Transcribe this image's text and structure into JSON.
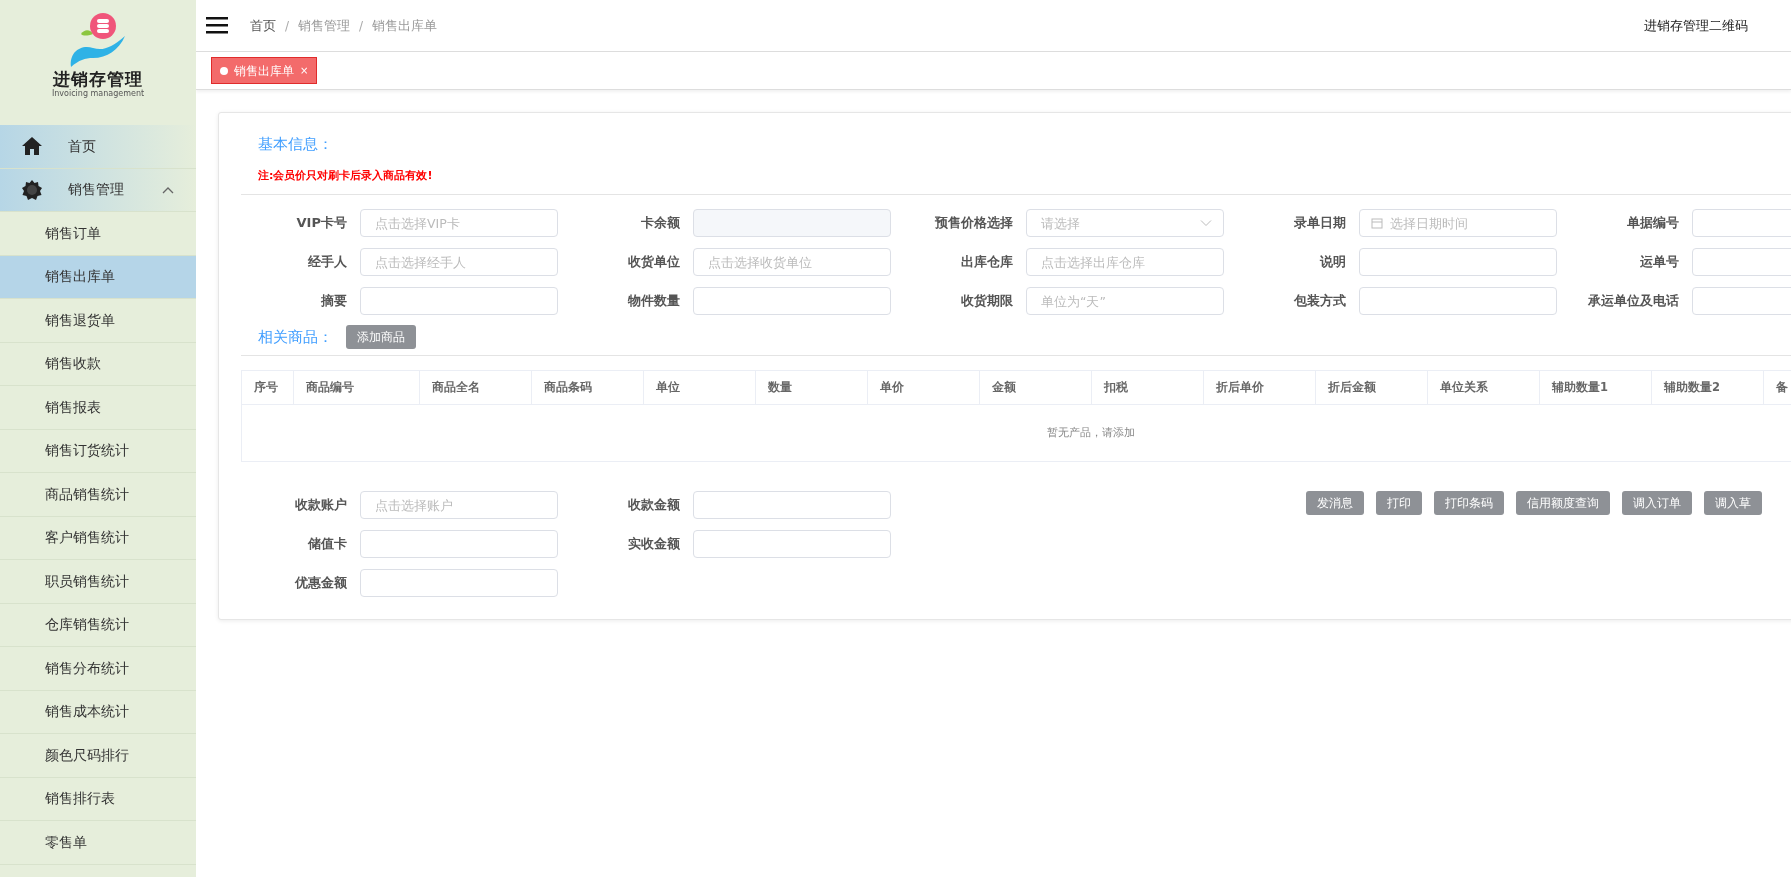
{
  "sidebar": {
    "logo": {
      "title": "进销存管理",
      "subtitle": "Invoicing management"
    },
    "items": [
      {
        "label": "首页",
        "selected": false
      },
      {
        "label": "销售管理",
        "selected": false,
        "expanded": true,
        "children": [
          {
            "label": "销售订单",
            "selected": false
          },
          {
            "label": "销售出库单",
            "selected": true
          },
          {
            "label": "销售退货单",
            "selected": false
          },
          {
            "label": "销售收款",
            "selected": false
          },
          {
            "label": "销售报表",
            "selected": false
          },
          {
            "label": "销售订货统计",
            "selected": false
          },
          {
            "label": "商品销售统计",
            "selected": false
          },
          {
            "label": "客户销售统计",
            "selected": false
          },
          {
            "label": "职员销售统计",
            "selected": false
          },
          {
            "label": "仓库销售统计",
            "selected": false
          },
          {
            "label": "销售分布统计",
            "selected": false
          },
          {
            "label": "销售成本统计",
            "selected": false
          },
          {
            "label": "颜色尺码排行",
            "selected": false
          },
          {
            "label": "销售排行表",
            "selected": false
          },
          {
            "label": "零售单",
            "selected": false
          }
        ]
      }
    ]
  },
  "header": {
    "breadcrumb": [
      {
        "kind": "link",
        "text": "首页"
      },
      {
        "kind": "separator",
        "text": "/"
      },
      {
        "kind": "link",
        "text": "销售管理"
      },
      {
        "kind": "separator",
        "text": "/"
      },
      {
        "kind": "link",
        "text": "销售出库单"
      }
    ],
    "links": [
      "进销存管理二维码"
    ]
  },
  "tabs": [
    {
      "label": "销售出库单",
      "selected": true,
      "close": "×"
    }
  ],
  "basic_info": {
    "title": "基本信息：",
    "note": "注:会员价只对刷卡后录入商品有效!",
    "fields": [
      {
        "label": "VIP卡号",
        "kind": "text",
        "placeholder": "点击选择VIP卡"
      },
      {
        "label": "卡余额",
        "kind": "disabled"
      },
      {
        "label": "预售价格选择",
        "kind": "select",
        "placeholder": "请选择"
      },
      {
        "label": "录单日期",
        "kind": "date",
        "placeholder": "选择日期时间"
      },
      {
        "label": "单据编号",
        "kind": "text"
      },
      {
        "label": "经手人",
        "kind": "text",
        "placeholder": "点击选择经手人"
      },
      {
        "label": "收货单位",
        "kind": "text",
        "placeholder": "点击选择收货单位"
      },
      {
        "label": "出库仓库",
        "kind": "text",
        "placeholder": "点击选择出库仓库"
      },
      {
        "label": "说明",
        "kind": "text"
      },
      {
        "label": "运单号",
        "kind": "text"
      },
      {
        "label": "摘要",
        "kind": "text"
      },
      {
        "label": "物件数量",
        "kind": "text"
      },
      {
        "label": "收货期限",
        "kind": "text",
        "placeholder": "单位为“天”"
      },
      {
        "label": "包装方式",
        "kind": "text"
      },
      {
        "label": "承运单位及电话",
        "kind": "text"
      }
    ]
  },
  "products": {
    "title": "相关商品：",
    "add_button": "添加商品",
    "columns": [
      "序号",
      "商品编号",
      "商品全名",
      "商品条码",
      "单位",
      "数量",
      "单价",
      "金额",
      "扣税",
      "折后单价",
      "折后金额",
      "单位关系",
      "辅助数量1",
      "辅助数量2",
      "备"
    ],
    "empty_text": "暂无产品，请添加"
  },
  "payment": {
    "fields": [
      {
        "label": "收款账户",
        "placeholder": "点击选择账户"
      },
      {
        "label": "收款金额"
      },
      {
        "label": "储值卡"
      },
      {
        "label": "实收金额"
      },
      {
        "label": "优惠金额"
      }
    ]
  },
  "actions": [
    "发消息",
    "打印",
    "打印条码",
    "信用额度查询",
    "调入订单",
    "调入草"
  ]
}
